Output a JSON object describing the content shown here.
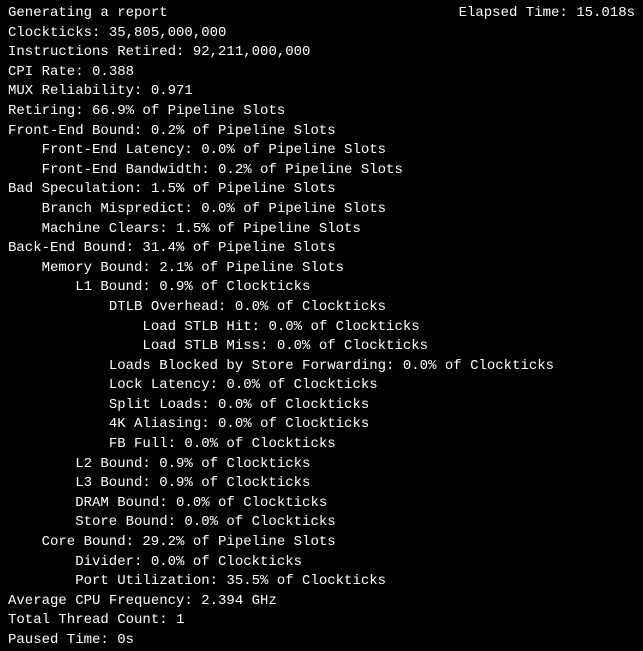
{
  "header": {
    "title": "Generating a report",
    "elapsed_label": "Elapsed Time:",
    "elapsed_value": "15.018s"
  },
  "metrics": {
    "clockticks": "Clockticks: 35,805,000,000",
    "instructions_retired": "Instructions Retired: 92,211,000,000",
    "cpi_rate": "CPI Rate: 0.388",
    "mux_reliability": "MUX Reliability: 0.971",
    "retiring": "Retiring: 66.9% of Pipeline Slots",
    "front_end_bound": "Front-End Bound: 0.2% of Pipeline Slots",
    "front_end_latency": "Front-End Latency: 0.0% of Pipeline Slots",
    "front_end_bandwidth": "Front-End Bandwidth: 0.2% of Pipeline Slots",
    "bad_speculation": "Bad Speculation: 1.5% of Pipeline Slots",
    "branch_mispredict": "Branch Mispredict: 0.0% of Pipeline Slots",
    "machine_clears": "Machine Clears: 1.5% of Pipeline Slots",
    "back_end_bound": "Back-End Bound: 31.4% of Pipeline Slots",
    "memory_bound": "Memory Bound: 2.1% of Pipeline Slots",
    "l1_bound": "L1 Bound: 0.9% of Clockticks",
    "dtlb_overhead": "DTLB Overhead: 0.0% of Clockticks",
    "load_stlb_hit": "Load STLB Hit: 0.0% of Clockticks",
    "load_stlb_miss": "Load STLB Miss: 0.0% of Clockticks",
    "loads_blocked": "Loads Blocked by Store Forwarding: 0.0% of Clockticks",
    "lock_latency": "Lock Latency: 0.0% of Clockticks",
    "split_loads": "Split Loads: 0.0% of Clockticks",
    "aliasing_4k": "4K Aliasing: 0.0% of Clockticks",
    "fb_full": "FB Full: 0.0% of Clockticks",
    "l2_bound": "L2 Bound: 0.9% of Clockticks",
    "l3_bound": "L3 Bound: 0.9% of Clockticks",
    "dram_bound": "DRAM Bound: 0.0% of Clockticks",
    "store_bound": "Store Bound: 0.0% of Clockticks",
    "core_bound": "Core Bound: 29.2% of Pipeline Slots",
    "divider": "Divider: 0.0% of Clockticks",
    "port_utilization": "Port Utilization: 35.5% of Clockticks",
    "avg_cpu_freq": "Average CPU Frequency: 2.394 GHz",
    "total_thread_count": "Total Thread Count: 1",
    "paused_time": "Paused Time: 0s"
  }
}
